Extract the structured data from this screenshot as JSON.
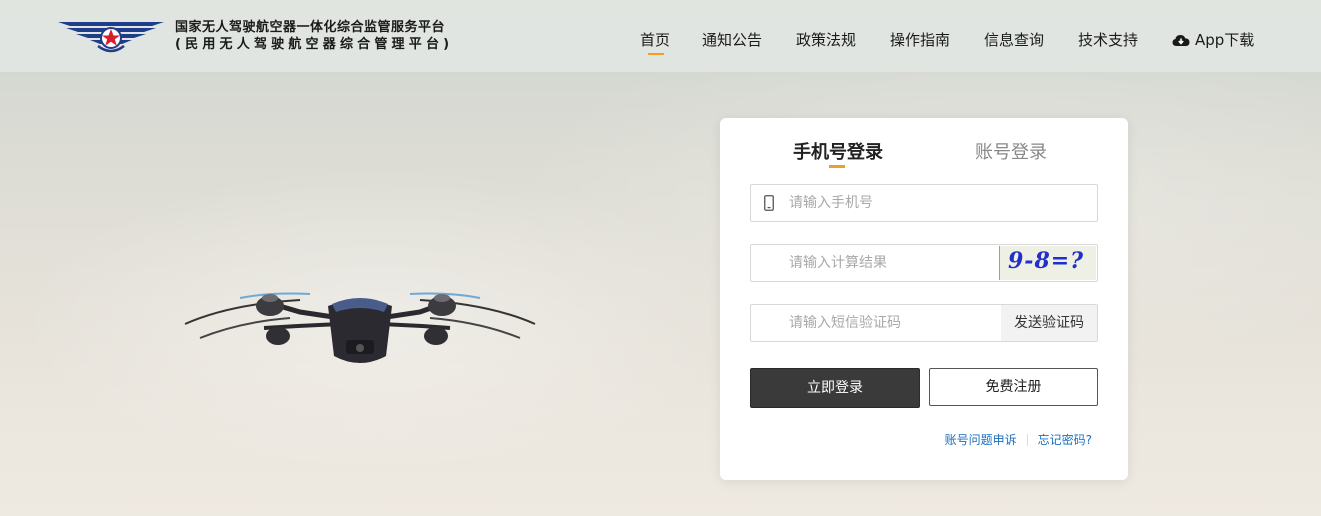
{
  "brand": {
    "line1": "国家无人驾驶航空器一体化综合监管服务平台",
    "line2": "(民用无人驾驶航空器综合管理平台)"
  },
  "nav": {
    "items": [
      {
        "label": "首页",
        "active": true
      },
      {
        "label": "通知公告",
        "active": false
      },
      {
        "label": "政策法规",
        "active": false
      },
      {
        "label": "操作指南",
        "active": false
      },
      {
        "label": "信息查询",
        "active": false
      },
      {
        "label": "技术支持",
        "active": false
      }
    ],
    "app_download": "App下载",
    "accent": "#f0a020"
  },
  "login": {
    "tabs": [
      {
        "label": "手机号登录",
        "active": true
      },
      {
        "label": "账号登录",
        "active": false
      }
    ],
    "phone_placeholder": "请输入手机号",
    "calc_placeholder": "请输入计算结果",
    "captcha_text": "9-8=?",
    "sms_placeholder": "请输入短信验证码",
    "send_code_label": "发送验证码",
    "login_button": "立即登录",
    "register_button": "免费注册",
    "appeal_link": "账号问题申诉",
    "forgot_link": "忘记密码?"
  }
}
